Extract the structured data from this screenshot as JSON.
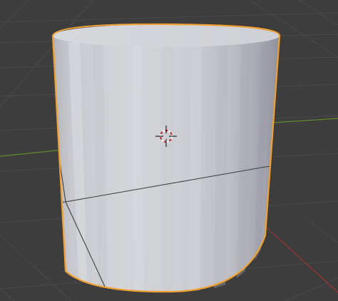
{
  "viewport": {
    "view": "3d-viewport",
    "background_color": "#3d3d3d",
    "grid_color": "#4a4a4a",
    "x_axis_color": "#9a3535",
    "y_axis_color": "#5f8a2c",
    "selection_outline_color": "#f0a030",
    "cursor_colors": {
      "ring_red": "#c03030",
      "ring_white": "#ffffff",
      "crosshair": "#000000"
    }
  },
  "object": {
    "type": "cylinder",
    "selected": true,
    "shading": "solid"
  }
}
